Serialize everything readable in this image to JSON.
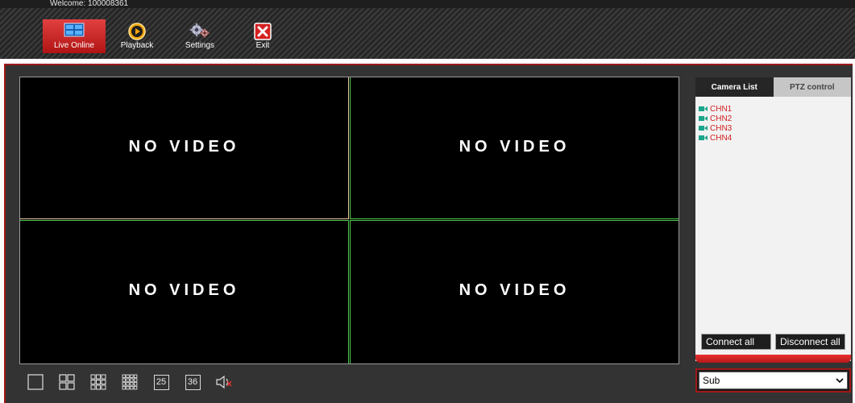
{
  "header": {
    "welcome": "Welcome: 100008361"
  },
  "nav": [
    {
      "label": "Live Online",
      "icon": "live-monitor-icon",
      "active": true
    },
    {
      "label": "Playback",
      "icon": "play-circle-icon",
      "active": false
    },
    {
      "label": "Settings",
      "icon": "gears-icon",
      "active": false
    },
    {
      "label": "Exit",
      "icon": "close-x-icon",
      "active": false
    }
  ],
  "video": {
    "cells": [
      "NO VIDEO",
      "NO VIDEO",
      "NO VIDEO",
      "NO VIDEO"
    ]
  },
  "toolbar": {
    "layout_25": "25",
    "layout_36": "36"
  },
  "panel": {
    "tabs": [
      "Camera List",
      "PTZ control"
    ],
    "active_tab": "Camera List",
    "cameras": [
      "CHN1",
      "CHN2",
      "CHN3",
      "CHN4"
    ],
    "connect_all": "Connect all",
    "disconnect_all": "Disconnect all"
  },
  "stream": {
    "selected": "Sub"
  },
  "colors": {
    "accent_red": "#b01414",
    "camera_text": "#d22020",
    "grid_green": "#4ec84e",
    "camera_icon": "#1aa58a"
  }
}
